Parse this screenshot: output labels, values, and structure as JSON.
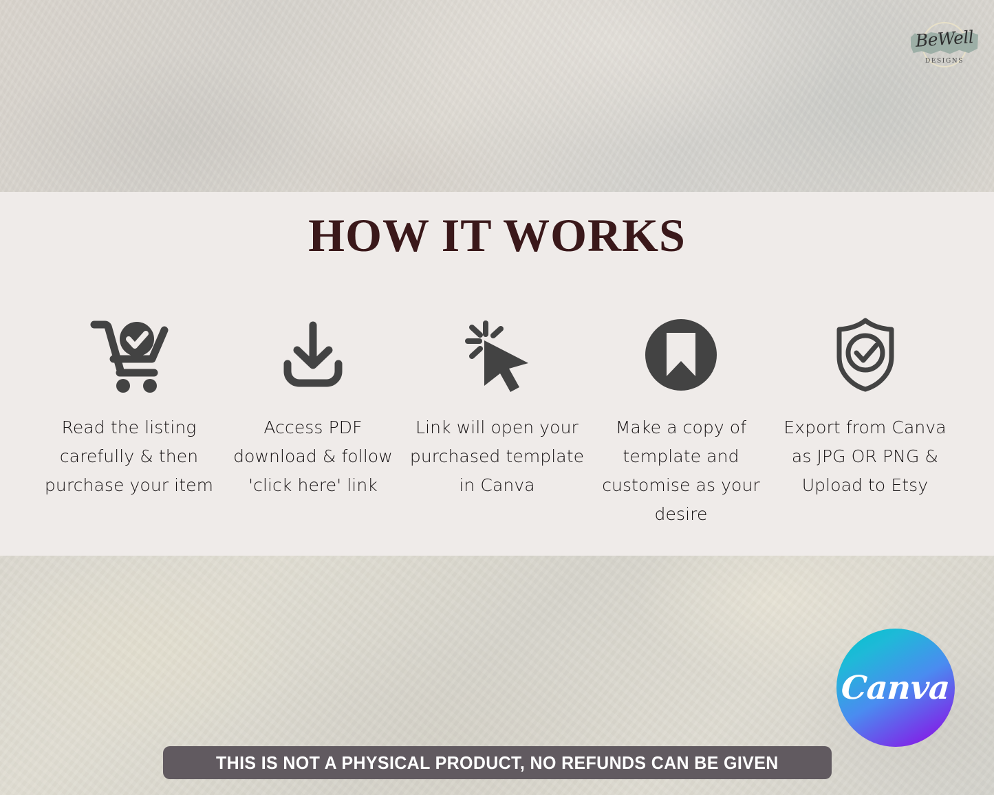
{
  "brand": {
    "logo_name": "BeWell",
    "logo_subtitle": "DESIGNS",
    "logo_brush_color": "#9aada4"
  },
  "panel": {
    "title": "HOW IT WORKS",
    "background_color": "#efebe9",
    "title_color": "#3a181a"
  },
  "steps": [
    {
      "icon": "shopping-cart-check-icon",
      "caption": "Read the listing carefully & then purchase your item"
    },
    {
      "icon": "download-tray-icon",
      "caption": "Access PDF download & follow 'click here' link"
    },
    {
      "icon": "click-cursor-icon",
      "caption": "Link will open your purchased template in Canva"
    },
    {
      "icon": "bookmark-circle-icon",
      "caption": "Make a copy of template and customise as your desire"
    },
    {
      "icon": "shield-check-icon",
      "caption": "Export from Canva as JPG OR PNG & Upload to Etsy"
    }
  ],
  "icon_color": "#434343",
  "canva": {
    "wordmark": "Canva",
    "gradient_start": "#00c4cc",
    "gradient_end": "#8b1ff0"
  },
  "disclaimer": {
    "text": "THIS IS NOT A PHYSICAL PRODUCT, NO REFUNDS CAN BE GIVEN",
    "background_color": "#615a60",
    "text_color": "#ffffff"
  }
}
